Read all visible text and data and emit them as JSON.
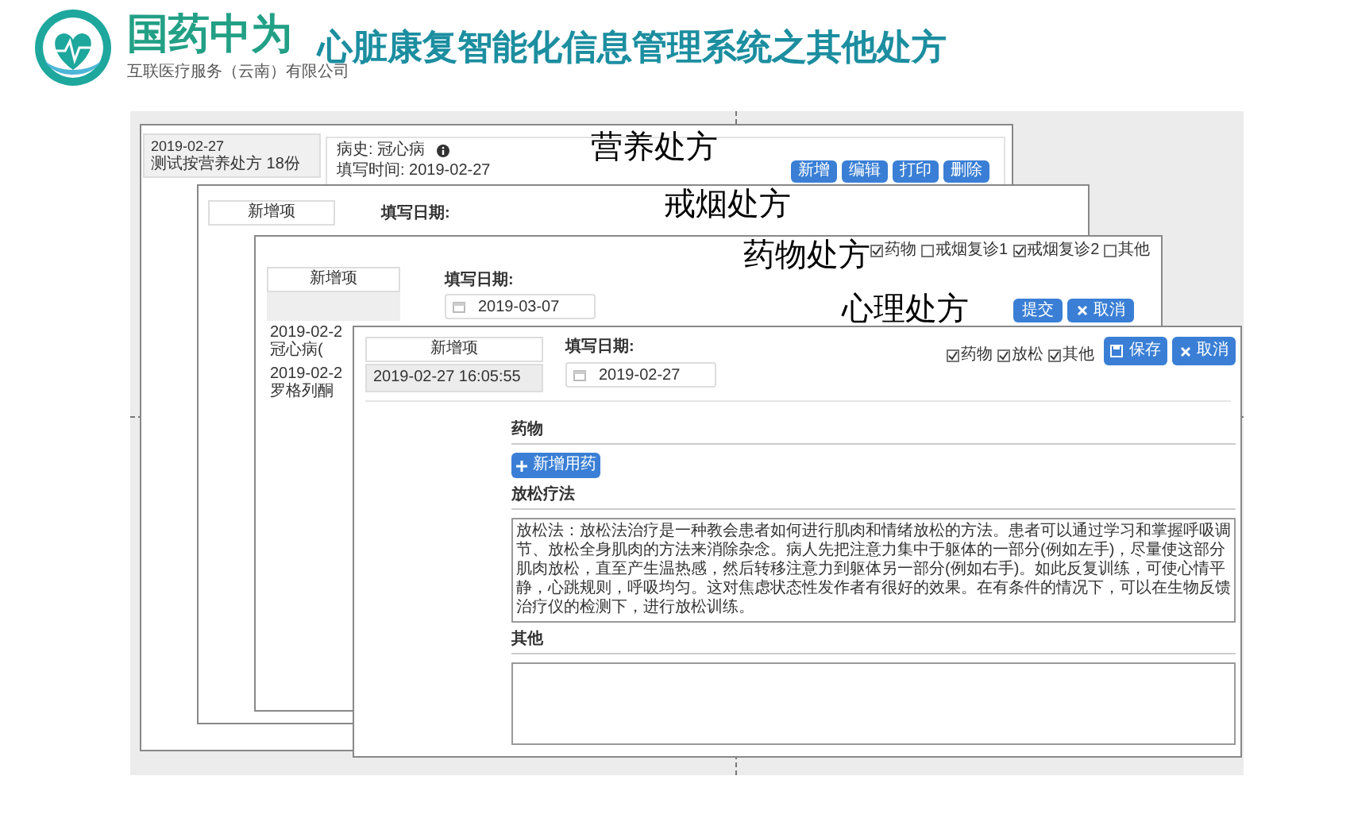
{
  "header": {
    "brand": "国药中为",
    "company": "互联医疗服务（云南）有限公司",
    "title": "心脏康复智能化信息管理系统之其他处方"
  },
  "nutrition": {
    "label": "营养处方",
    "record": {
      "date": "2019-02-27",
      "summary": "测试按营养处方 18份"
    },
    "history": "病史: 冠心病",
    "fill_time": "填写时间: 2019-02-27",
    "buttons": [
      "新增",
      "编辑",
      "打印",
      "删除"
    ]
  },
  "smoking": {
    "label": "戒烟处方",
    "list_header": "新增项",
    "date_label": "填写日期:"
  },
  "medication": {
    "label": "药物处方",
    "list_header": "新增项",
    "records": [
      {
        "date": "2019-02-2",
        "note": "冠心病("
      },
      {
        "date": "2019-02-2",
        "note": "罗格列酮"
      }
    ],
    "date_label": "填写日期:",
    "date_value": "2019-03-07",
    "options": [
      {
        "label": "药物",
        "checked": true
      },
      {
        "label": "戒烟复诊1",
        "checked": false
      },
      {
        "label": "戒烟复诊2",
        "checked": true
      },
      {
        "label": "其他",
        "checked": false
      }
    ],
    "buttons": [
      {
        "label": "提交",
        "kind": "plain"
      },
      {
        "label": "取消",
        "kind": "cancel"
      }
    ]
  },
  "psychology": {
    "label": "心理处方",
    "list_header": "新增项",
    "entries": [
      {
        "text": "2019-02-27 16:05:55",
        "selected": true
      }
    ],
    "date_label": "填写日期:",
    "date_value": "2019-02-27",
    "options": [
      {
        "label": "药物",
        "checked": true
      },
      {
        "label": "放松",
        "checked": true
      },
      {
        "label": "其他",
        "checked": true
      }
    ],
    "buttons": [
      {
        "label": "保存",
        "kind": "save"
      },
      {
        "label": "取消",
        "kind": "cancel"
      }
    ],
    "sections": [
      {
        "title": "药物",
        "kind": "button",
        "button": "新增用药"
      },
      {
        "title": "放松疗法",
        "kind": "textarea",
        "value": "放松法：放松法治疗是一种教会患者如何进行肌肉和情绪放松的方法。患者可以通过学习和掌握呼吸调节、放松全身肌肉的方法来消除杂念。病人先把注意力集中于躯体的一部分(例如左手)，尽量使这部分肌肉放松，直至产生温热感，然后转移注意力到躯体另一部分(例如右手)。如此反复训练，可使心情平静，心跳规则，呼吸均匀。这对焦虑状态性发作者有很好的效果。在有条件的情况下，可以在生物反馈治疗仪的检测下，进行放松训练。"
      },
      {
        "title": "其他",
        "kind": "textarea"
      }
    ]
  }
}
